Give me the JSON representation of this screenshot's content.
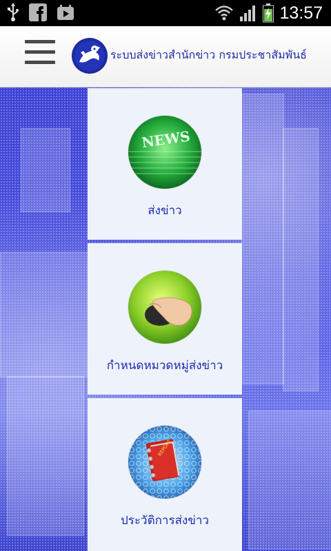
{
  "status_bar": {
    "time": "13:57",
    "left_icons": [
      "usb-icon",
      "facebook-icon",
      "play-store-icon"
    ],
    "right_icons": [
      "wifi-icon",
      "signal-icon",
      "battery-charging-icon"
    ]
  },
  "header": {
    "title": "ระบบส่งข่าวสำนักข่าว กรมประชาสัมพันธ์",
    "menu_icon": "hamburger-menu-icon",
    "logo_icon": "department-logo-icon"
  },
  "menu": {
    "items": [
      {
        "label": "ส่งข่าว",
        "icon": "news-icon"
      },
      {
        "label": "กำหนดหมวดหมู่ส่งข่าว",
        "icon": "mouse-hand-icon"
      },
      {
        "label": "ประวัติการส่งข่าว",
        "icon": "report-book-icon"
      }
    ]
  },
  "colors": {
    "title": "#1f2aa8",
    "label": "#1d2bb0",
    "background": "#3a3fd0",
    "card": "#eef3fb"
  }
}
